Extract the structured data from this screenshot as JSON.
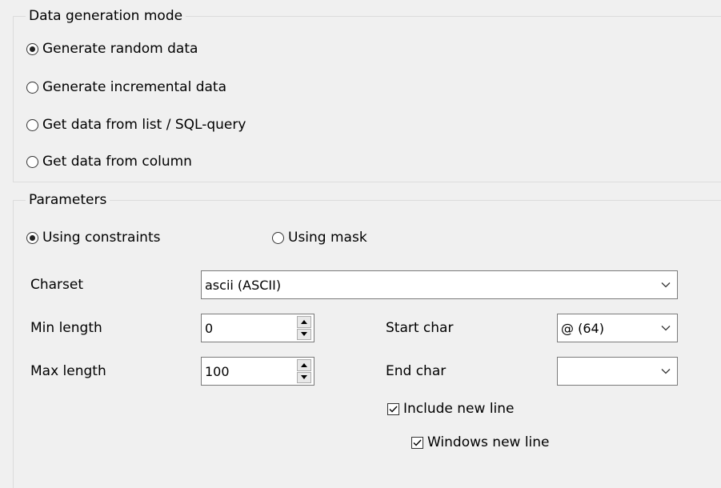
{
  "generation_mode": {
    "title": "Data generation mode",
    "options": [
      {
        "label": "Generate random data",
        "checked": true
      },
      {
        "label": "Generate incremental data",
        "checked": false
      },
      {
        "label": "Get data from list / SQL-query",
        "checked": false
      },
      {
        "label": "Get data from column",
        "checked": false
      }
    ]
  },
  "parameters": {
    "title": "Parameters",
    "modes": [
      {
        "label": "Using constraints",
        "checked": true
      },
      {
        "label": "Using mask",
        "checked": false
      }
    ],
    "charset": {
      "label": "Charset",
      "value": "ascii (ASCII)"
    },
    "min_length": {
      "label": "Min length",
      "value": "0"
    },
    "max_length": {
      "label": "Max length",
      "value": "100"
    },
    "start_char": {
      "label": "Start char",
      "value": "@ (64)"
    },
    "end_char": {
      "label": "End char",
      "value": ""
    },
    "include_new_line": {
      "label": "Include new line",
      "checked": true
    },
    "windows_new_line": {
      "label": "Windows new line",
      "checked": true
    }
  },
  "icons": {
    "dropdown": "chevron-down-icon",
    "spin_up": "spin-up-icon",
    "spin_down": "spin-down-icon",
    "check": "checkmark-icon"
  }
}
